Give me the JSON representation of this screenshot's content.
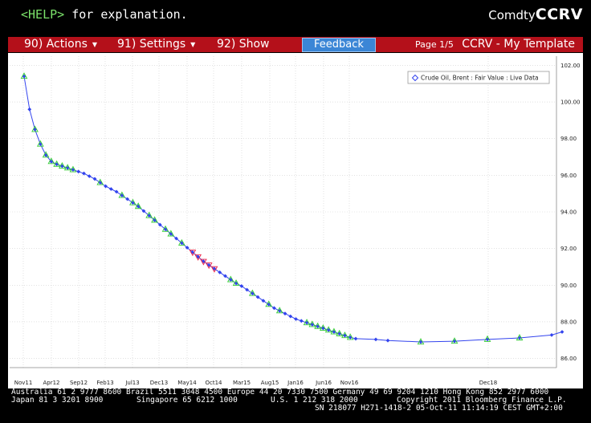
{
  "help": {
    "key": "<HELP>",
    "text": " for explanation."
  },
  "ticker": {
    "prefix": "Comdty",
    "code": "CCRV"
  },
  "menu": {
    "actions": "90) Actions",
    "settings": "91) Settings",
    "show": "92) Show",
    "feedback": "Feedback",
    "page": "Page 1/5",
    "template": "CCRV - My Template"
  },
  "colors": {
    "accent_red": "#b4101a",
    "feedback_blue": "#3b86d6",
    "help_green": "#7be26a",
    "series_line": "#3344ee",
    "marker_up": "#33cc33",
    "marker_down": "#ee2244"
  },
  "chart_data": {
    "type": "line",
    "legend": {
      "label": "Crude Oil, Brent : Fair Value : Live Data",
      "placement": "top-right"
    },
    "ylim": [
      85.5,
      102.5
    ],
    "yticks": [
      86,
      88,
      90,
      92,
      94,
      96,
      98,
      100,
      102
    ],
    "ytick_labels": [
      "86.00",
      "88.00",
      "90.00",
      "92.00",
      "94.00",
      "96.00",
      "98.00",
      "100.00",
      "102.00"
    ],
    "grid": true,
    "x_axis_labels": [
      "Nov11",
      "Apr12",
      "Sep12",
      "Feb13",
      "Jul13",
      "Dec13",
      "May14",
      "Oct14",
      "Mar15",
      "Aug15",
      "Jan16",
      "Jun16",
      "Nov16",
      "Dec18"
    ],
    "series": [
      {
        "values": [
          101.4,
          99.6,
          98.5,
          97.7,
          97.1,
          96.75,
          96.6,
          96.5,
          96.4,
          96.3,
          96.2,
          96.1,
          95.95,
          95.8,
          95.6,
          95.4,
          95.25,
          95.1,
          94.9,
          94.7,
          94.5,
          94.3,
          94.05,
          93.8,
          93.55,
          93.3,
          93.05,
          92.8,
          92.55,
          92.3,
          92.05,
          91.8,
          91.55,
          91.3,
          91.1,
          90.9,
          90.7,
          90.5,
          90.3,
          90.1,
          89.95,
          89.75,
          89.55,
          89.35,
          89.15,
          88.95,
          88.75,
          88.6,
          88.45,
          88.3,
          88.15,
          88.05,
          87.95,
          87.85,
          87.75,
          87.65,
          87.55,
          87.45,
          87.35,
          87.25,
          87.15,
          87.08,
          87.04,
          86.98,
          86.9,
          86.94,
          87.04,
          87.12,
          87.28,
          87.45
        ],
        "marker_types": [
          "up",
          "none",
          "up",
          "up",
          "up",
          "up",
          "up",
          "up",
          "up",
          "up",
          "none",
          "none",
          "none",
          "none",
          "up",
          "none",
          "none",
          "none",
          "up",
          "none",
          "up",
          "up",
          "none",
          "up",
          "up",
          "none",
          "up",
          "up",
          "none",
          "up",
          "none",
          "down",
          "down",
          "down",
          "down",
          "down",
          "none",
          "none",
          "up",
          "up",
          "none",
          "none",
          "up",
          "none",
          "none",
          "up",
          "none",
          "up",
          "none",
          "none",
          "none",
          "none",
          "up",
          "up",
          "up",
          "up",
          "up",
          "up",
          "up",
          "up",
          "up",
          "none",
          "none",
          "none",
          "up",
          "up",
          "up",
          "up",
          "none",
          "none"
        ]
      }
    ]
  },
  "footer": {
    "line1": "Australia 61 2 9777 8600 Brazil 5511 3048 4500 Europe 44 20 7330 7500 Germany 49 69 9204 1210 Hong Kong 852 2977 6000",
    "line2a": "Japan 81 3 3201 8900",
    "line2b": "Singapore 65 6212 1000",
    "line2c": "U.S. 1 212 318 2000",
    "line2d": "Copyright 2011 Bloomberg Finance L.P.",
    "line3": "SN 218077 H271-1418-2 05-Oct-11 11:14:19 CEST GMT+2:00"
  }
}
